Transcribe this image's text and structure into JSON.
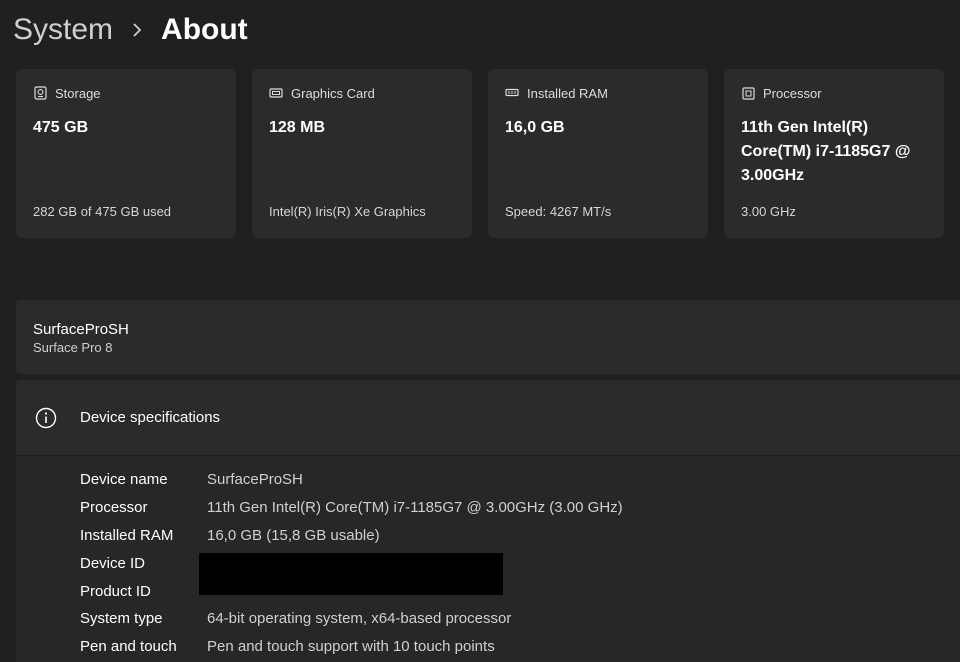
{
  "breadcrumb": {
    "parent": "System",
    "separator": "›",
    "current": "About"
  },
  "cards": [
    {
      "icon": "storage-icon",
      "title": "Storage",
      "value": "475 GB",
      "sub": "282 GB of 475 GB used"
    },
    {
      "icon": "graphics-card-icon",
      "title": "Graphics Card",
      "value": "128 MB",
      "sub": "Intel(R) Iris(R) Xe Graphics"
    },
    {
      "icon": "ram-icon",
      "title": "Installed RAM",
      "value": "16,0 GB",
      "sub": "Speed: 4267 MT/s"
    },
    {
      "icon": "processor-icon",
      "title": "Processor",
      "value": "11th Gen Intel(R) Core(TM) i7-1185G7 @ 3.00GHz",
      "sub": "3.00 GHz"
    }
  ],
  "device": {
    "name": "SurfaceProSH",
    "model": "Surface Pro 8"
  },
  "specs": {
    "title": "Device specifications",
    "rows": [
      {
        "label": "Device name",
        "value": "SurfaceProSH"
      },
      {
        "label": "Processor",
        "value": "11th Gen Intel(R) Core(TM) i7-1185G7 @ 3.00GHz (3.00 GHz)"
      },
      {
        "label": "Installed RAM",
        "value": "16,0 GB (15,8 GB usable)"
      },
      {
        "label": "Device ID",
        "value": ""
      },
      {
        "label": "Product ID",
        "value": ""
      },
      {
        "label": "System type",
        "value": "64-bit operating system, x64-based processor"
      },
      {
        "label": "Pen and touch",
        "value": "Pen and touch support with 10 touch points"
      }
    ]
  },
  "colors": {
    "background": "#202020",
    "card": "#2b2b2b",
    "text": "#ffffff",
    "secondary_text": "#d0d0d0",
    "redaction": "#000000"
  }
}
